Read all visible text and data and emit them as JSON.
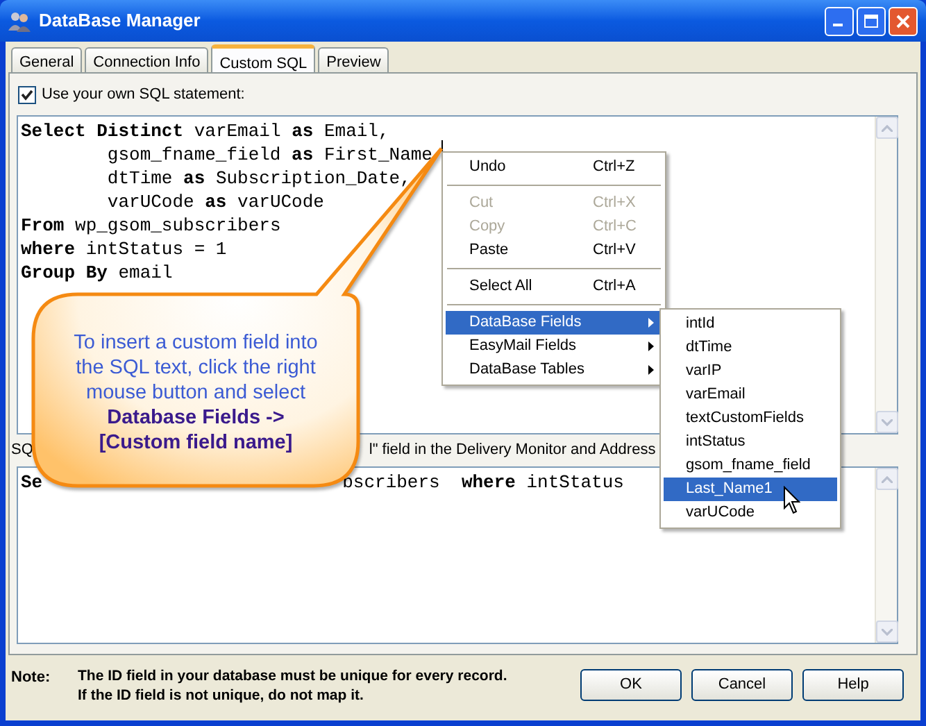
{
  "window": {
    "title": "DataBase Manager"
  },
  "tabs": [
    {
      "label": "General",
      "selected": false
    },
    {
      "label": "Connection Info",
      "selected": false
    },
    {
      "label": "Custom SQL",
      "selected": true
    },
    {
      "label": "Preview",
      "selected": false
    }
  ],
  "sql_option": {
    "label": "Use your own SQL statement:",
    "checked": true
  },
  "sql_editor": {
    "lines": [
      "**Select** **Distinct** varEmail **as** Email,",
      "        gsom_fname_field **as** First_Name",
      "        dtTime **as** Subscription_Date,",
      "        varUCode **as** varUCode",
      "**From** wp_gsom_subscribers",
      "**where** intStatus = 1",
      "**Group** **By** email"
    ]
  },
  "id_label": {
    "text_1": "SQ",
    "text_2": "l\" field in the Delivery Monitor and Address"
  },
  "id_editor": {
    "text_1": "**Se**",
    "text_2": "bscribers  **where** intStatus"
  },
  "note": {
    "label": "Note:",
    "lines": [
      "The ID field in your database must be unique for every record.",
      "If the ID field is not unique, do not map it."
    ]
  },
  "buttons": [
    {
      "label": "OK"
    },
    {
      "label": "Cancel"
    },
    {
      "label": "Help"
    }
  ],
  "context_menu": {
    "items": [
      {
        "kind": "item",
        "label": "Undo",
        "shortcut": "Ctrl+Z",
        "disabled": false,
        "selected": false
      },
      {
        "kind": "separator"
      },
      {
        "kind": "item",
        "label": "Cut",
        "shortcut": "Ctrl+X",
        "disabled": true,
        "selected": false
      },
      {
        "kind": "item",
        "label": "Copy",
        "shortcut": "Ctrl+C",
        "disabled": true,
        "selected": false
      },
      {
        "kind": "item",
        "label": "Paste",
        "shortcut": "Ctrl+V",
        "disabled": false,
        "selected": false
      },
      {
        "kind": "separator"
      },
      {
        "kind": "item",
        "label": "Select All",
        "shortcut": "Ctrl+A",
        "disabled": false,
        "selected": false
      },
      {
        "kind": "separator"
      },
      {
        "kind": "submenu",
        "label": "DataBase Fields",
        "disabled": false,
        "selected": true
      },
      {
        "kind": "submenu",
        "label": "EasyMail Fields",
        "disabled": false,
        "selected": false
      },
      {
        "kind": "submenu",
        "label": "DataBase Tables",
        "disabled": false,
        "selected": false
      }
    ]
  },
  "submenu": {
    "items": [
      {
        "label": "intId",
        "selected": false
      },
      {
        "label": "dtTime",
        "selected": false
      },
      {
        "label": "varIP",
        "selected": false
      },
      {
        "label": "varEmail",
        "selected": false
      },
      {
        "label": "textCustomFields",
        "selected": false
      },
      {
        "label": "intStatus",
        "selected": false
      },
      {
        "label": "gsom_fname_field",
        "selected": false
      },
      {
        "label": "Last_Name1",
        "selected": true
      },
      {
        "label": "varUCode",
        "selected": false
      }
    ]
  },
  "callout": {
    "lines": [
      {
        "kind": "plain",
        "text": "To insert a custom field into"
      },
      {
        "kind": "plain",
        "text": "the SQL text, click the right"
      },
      {
        "kind": "plain",
        "text": "mouse button and select"
      },
      {
        "kind": "strong",
        "text": "Database Fields ->"
      },
      {
        "kind": "strong",
        "text": "[Custom field name]"
      }
    ]
  }
}
